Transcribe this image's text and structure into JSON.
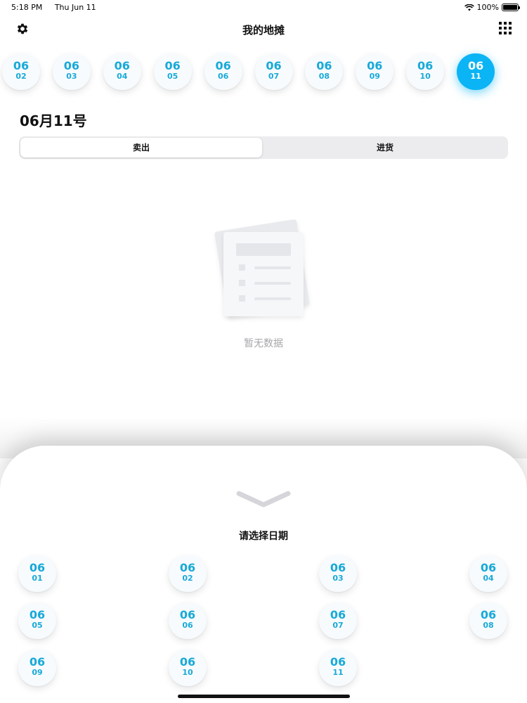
{
  "status_bar": {
    "time": "5:18 PM",
    "date": "Thu Jun 11",
    "battery": "100%"
  },
  "nav": {
    "title": "我的地摊",
    "left_icon": "gear-icon",
    "right_icon": "grid-icon"
  },
  "date_strip": [
    {
      "month": "06",
      "day": "02",
      "active": false
    },
    {
      "month": "06",
      "day": "03",
      "active": false
    },
    {
      "month": "06",
      "day": "04",
      "active": false
    },
    {
      "month": "06",
      "day": "05",
      "active": false
    },
    {
      "month": "06",
      "day": "06",
      "active": false
    },
    {
      "month": "06",
      "day": "07",
      "active": false
    },
    {
      "month": "06",
      "day": "08",
      "active": false
    },
    {
      "month": "06",
      "day": "09",
      "active": false
    },
    {
      "month": "06",
      "day": "10",
      "active": false
    },
    {
      "month": "06",
      "day": "11",
      "active": true
    }
  ],
  "date_heading": "06月11号",
  "segmented": {
    "sell": "卖出",
    "buy": "进货",
    "selected": "sell"
  },
  "empty_state": {
    "text": "暂无数据",
    "icon": "empty-document-icon"
  },
  "sheet": {
    "title": "请选择日期",
    "collapse_icon": "chevron-down-icon",
    "dates": [
      {
        "month": "06",
        "day": "01"
      },
      {
        "month": "06",
        "day": "02"
      },
      {
        "month": "06",
        "day": "03"
      },
      {
        "month": "06",
        "day": "04"
      },
      {
        "month": "06",
        "day": "05"
      },
      {
        "month": "06",
        "day": "06"
      },
      {
        "month": "06",
        "day": "07"
      },
      {
        "month": "06",
        "day": "08"
      },
      {
        "month": "06",
        "day": "09"
      },
      {
        "month": "06",
        "day": "10"
      },
      {
        "month": "06",
        "day": "11"
      }
    ]
  },
  "colors": {
    "accent": "#0bb4f4",
    "chip_text": "#19a9d8",
    "muted_text": "#a7a7ab"
  }
}
